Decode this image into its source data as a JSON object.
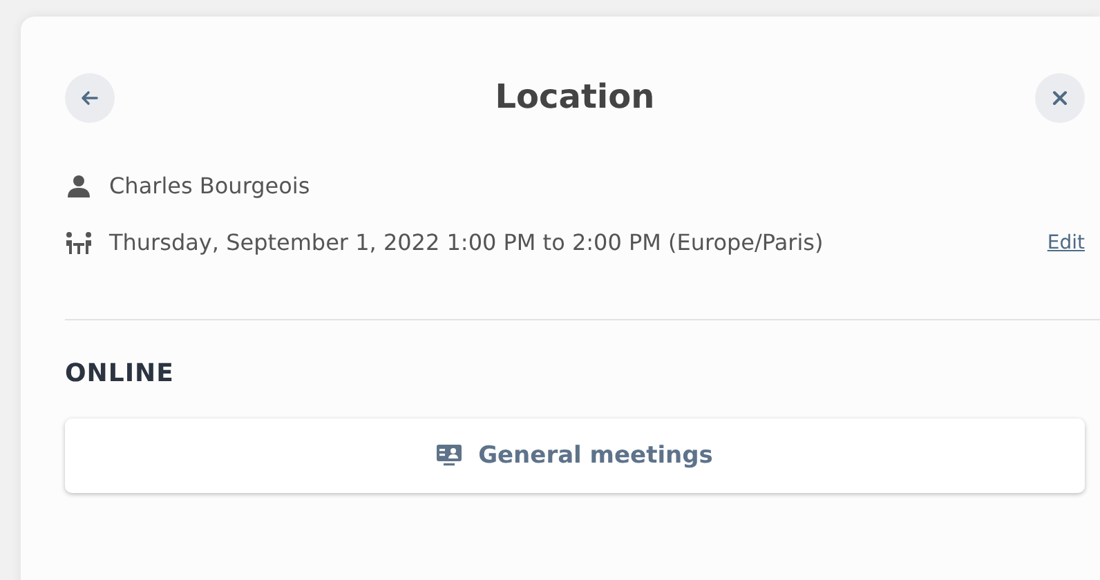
{
  "header": {
    "title": "Location"
  },
  "details": [
    {
      "kind": "person",
      "text": "Charles Bourgeois"
    },
    {
      "kind": "meeting",
      "text": "Thursday, September 1, 2022 1:00 PM to 2:00 PM (Europe/Paris)",
      "link": "Edit"
    }
  ],
  "section": {
    "heading": "ONLINE",
    "options": [
      {
        "label": "General meetings"
      }
    ]
  }
}
